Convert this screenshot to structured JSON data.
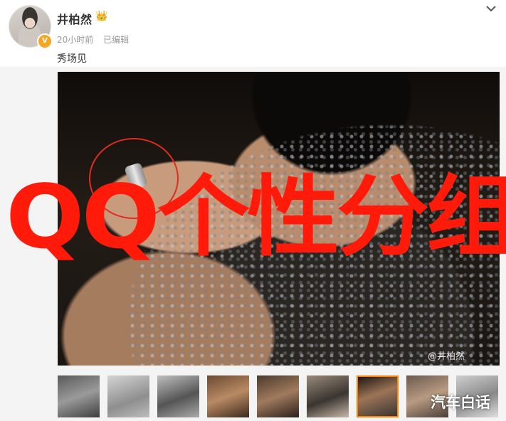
{
  "user": {
    "name": "井柏然",
    "crown": "👑"
  },
  "post": {
    "time": "20小时前",
    "edited": "已编辑",
    "text": "秀场见"
  },
  "photo": {
    "watermark": "@井柏然"
  },
  "overlay": {
    "text": "QQ个性分组"
  },
  "corner_watermark": "汽车白话",
  "icons": {
    "verified": "v-verified-icon",
    "menu": "chevron-down-icon"
  },
  "colors": {
    "accent": "#ff8200",
    "overlay": "#ff1a0a",
    "badge": "#f5a623"
  }
}
